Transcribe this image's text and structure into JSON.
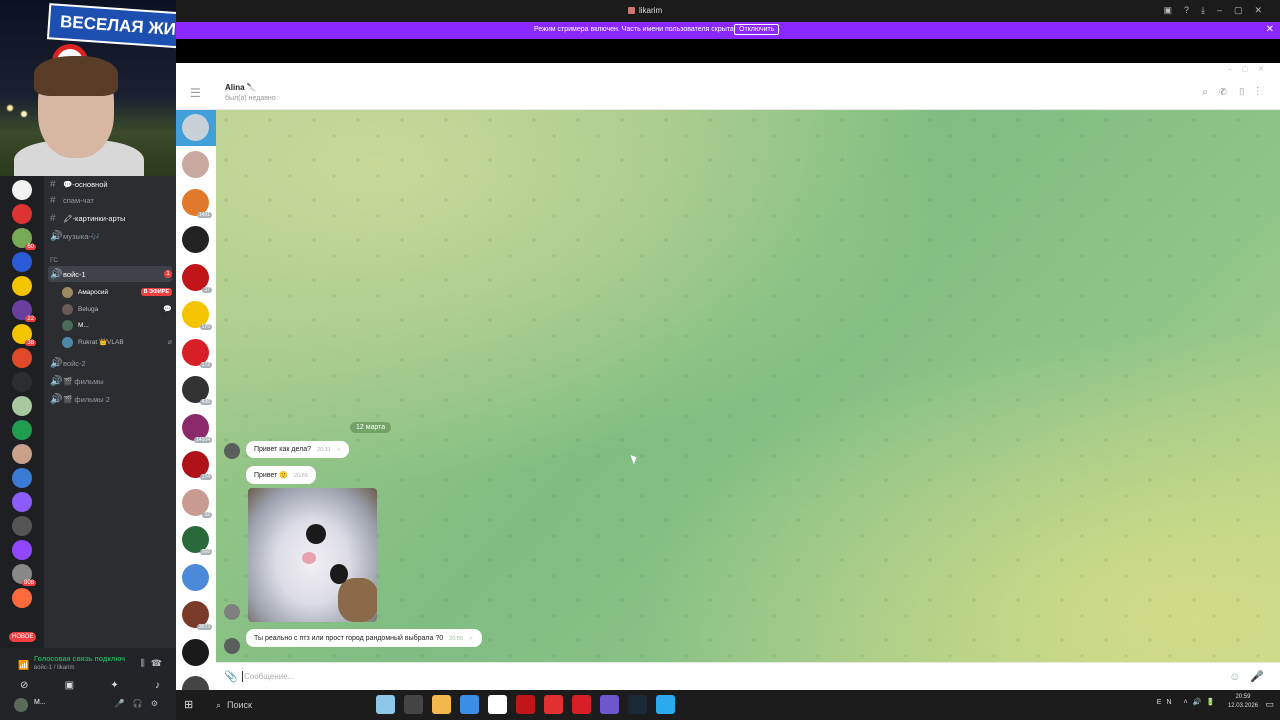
{
  "webcam": {
    "sign_text": "ВЕСЕЛАЯ ЖИЗ"
  },
  "discord": {
    "new_badge": "НОВОЕ",
    "server_badges": [
      "",
      "",
      "60",
      "",
      "",
      "22",
      "38",
      "",
      "",
      "",
      "",
      "",
      "",
      "",
      "",
      "",
      "808",
      ""
    ],
    "channels": [
      {
        "name": "💬-основной",
        "bright": true
      },
      {
        "name": "спам-чат",
        "bright": false
      },
      {
        "name": "🖍-картинки-арты",
        "bright": true
      },
      {
        "name": "музыка-🎶",
        "bright": false
      }
    ],
    "category": "ГС",
    "voice_channel": {
      "name": "войс-1",
      "badge": "1"
    },
    "voice_users": [
      {
        "name": "Амаросий",
        "live": "В ЭФИРЕ"
      },
      {
        "name": "Beluga",
        "live": ""
      },
      {
        "name": "М...",
        "live": ""
      },
      {
        "name": "Rukrat 👑VLAB",
        "live": ""
      }
    ],
    "voice_channels_more": [
      "войс-2",
      "🎬 фильмы",
      "🎬 фильмы 2"
    ],
    "voice_status": {
      "title": "Голосовая связь подключ",
      "subtitle": "войс-1 / likarim"
    },
    "user": {
      "name": "М..."
    }
  },
  "window": {
    "title": "likarim",
    "stream_banner": "Режим стримера включен. Часть имени пользователя скрыта.",
    "stream_button": "Отключить"
  },
  "telegram": {
    "header": {
      "name": "Alina 🔪",
      "status": "был(а) недавно"
    },
    "chat_badges": [
      "",
      "",
      "1491",
      "",
      "37",
      "175",
      "172",
      "436",
      "14104",
      "174",
      "32",
      "266",
      "",
      "3073",
      "",
      ""
    ],
    "date_label": "12 марта",
    "messages": [
      {
        "text": "Привет как дела?",
        "time": "20:31"
      },
      {
        "text": "Привет 🙂",
        "time": "20:56"
      },
      {
        "text": "Ты реально с птз или прост город рандомный выбрала ?0",
        "time": "20:56"
      }
    ],
    "input_placeholder": "Сообщение..."
  },
  "taskbar": {
    "search_label": "Поиск",
    "lang": "EN",
    "time": "20:59",
    "date": "12.03.2026",
    "app_colors": [
      "#8ec8e8",
      "#444",
      "#f2b84b",
      "#3a8ee6",
      "#ffffff",
      "#c0161a",
      "#e03030",
      "#d81f26",
      "#6e56cf",
      "#1b2838",
      "#2aabee"
    ]
  },
  "colors": {
    "discord_bg": "#2b2d31",
    "telegram_accent": "#419fd9",
    "stream_bar": "#8a29ff",
    "live_red": "#f23f43"
  }
}
